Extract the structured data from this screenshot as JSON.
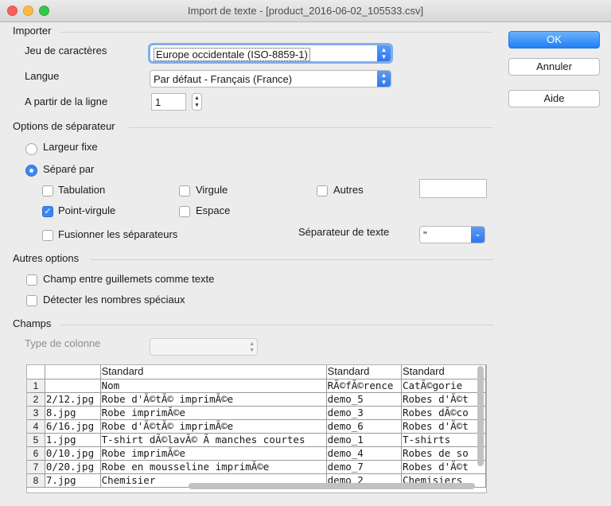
{
  "window": {
    "title": "Import de texte - [product_2016-06-02_105533.csv]"
  },
  "importer": {
    "section": "Importer",
    "charset_label": "Jeu de caractères",
    "charset_value": "Europe occidentale (ISO-8859-1)",
    "language_label": "Langue",
    "language_value": "Par défaut - Français (France)",
    "fromrow_label": "A partir de la ligne",
    "fromrow_value": "1"
  },
  "separator": {
    "section": "Options de séparateur",
    "fixed_width": "Largeur fixe",
    "separated_by": "Séparé par",
    "tab": "Tabulation",
    "comma": "Virgule",
    "other": "Autres",
    "other_value": "",
    "semicolon": "Point-virgule",
    "space": "Espace",
    "merge": "Fusionner les séparateurs",
    "text_delim_label": "Séparateur de texte",
    "text_delim_value": "\""
  },
  "other_options": {
    "section": "Autres options",
    "quoted_as_text": "Champ entre guillemets comme texte",
    "detect_special": "Détecter les nombres spéciaux"
  },
  "fields": {
    "section": "Champs",
    "column_type_label": "Type de colonne",
    "column_type_value": "",
    "headers": [
      "",
      "",
      "Standard",
      "Standard",
      "Standard"
    ],
    "rows": [
      [
        "1",
        "",
        "Nom",
        "RÃ©fÃ©rence",
        "CatÃ©gorie"
      ],
      [
        "2",
        "2/12.jpg",
        "Robe d'Ã©tÃ© imprimÃ©e",
        "demo_5",
        "Robes d'Ã©t"
      ],
      [
        "3",
        "8.jpg",
        "Robe imprimÃ©e",
        "demo_3",
        "Robes dÃ©co"
      ],
      [
        "4",
        "6/16.jpg",
        "Robe d'Ã©tÃ© imprimÃ©e",
        "demo_6",
        "Robes d'Ã©t"
      ],
      [
        "5",
        "1.jpg",
        "T-shirt dÃ©lavÃ© Ã  manches courtes",
        "demo_1",
        "T-shirts"
      ],
      [
        "6",
        "0/10.jpg",
        "Robe imprimÃ©e",
        "demo_4",
        "Robes de so"
      ],
      [
        "7",
        "0/20.jpg",
        "Robe en mousseline imprimÃ©e",
        "demo_7",
        "Robes d'Ã©t"
      ],
      [
        "8",
        "7.jpg",
        "Chemisier",
        "demo_2",
        "Chemisiers"
      ]
    ]
  },
  "buttons": {
    "ok": "OK",
    "cancel": "Annuler",
    "help": "Aide"
  },
  "colors": {
    "accent": "#3a86f5"
  }
}
